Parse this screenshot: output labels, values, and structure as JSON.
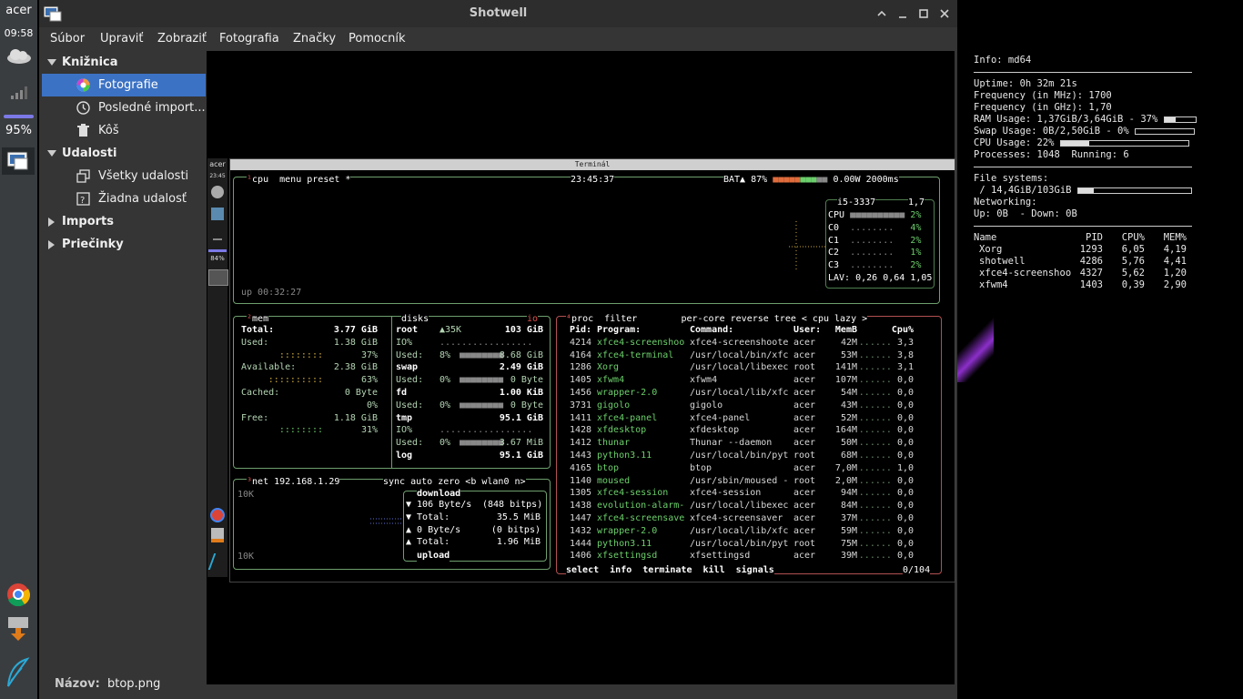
{
  "panel": {
    "user": "acer",
    "clock": "09:58",
    "battery": "95%"
  },
  "shotwell": {
    "title": "Shotwell",
    "menus": [
      "Súbor",
      "Upraviť",
      "Zobraziť",
      "Fotografia",
      "Značky",
      "Pomocník"
    ],
    "sidebar": [
      {
        "label": "Knižnica",
        "level": 0,
        "expand": "open"
      },
      {
        "label": "Fotografie",
        "level": 1,
        "selected": true,
        "icon": "photos-icon"
      },
      {
        "label": "Posledné import...",
        "level": 1,
        "icon": "clock-icon"
      },
      {
        "label": "Kôš",
        "level": 1,
        "icon": "trash-icon"
      },
      {
        "label": "Udalosti",
        "level": 0,
        "expand": "open"
      },
      {
        "label": "Všetky udalosti",
        "level": 1,
        "icon": "events-icon"
      },
      {
        "label": "Žiadna udalosť",
        "level": 1,
        "icon": "no-event-icon"
      },
      {
        "label": "Imports",
        "level": 0,
        "expand": "closed"
      },
      {
        "label": "Priečinky",
        "level": 0,
        "expand": "closed"
      }
    ],
    "status": {
      "label": "Názov:",
      "value": "btop.png"
    }
  },
  "terminal": {
    "title": "Terminál",
    "inner_user": "acer",
    "inner_time": "23:45",
    "inner_batt": "84%",
    "cpu_header": {
      "tabs": [
        "cpu",
        "menu",
        "preset *"
      ],
      "clock": "23:45:37",
      "bat": "BAT▲ 87%",
      "power": "0.00W",
      "rate": "2000ms"
    },
    "cpu_box": {
      "model": "i5-3337",
      "freq": "1,7",
      "rows": [
        [
          "CPU",
          "2%"
        ],
        [
          "C0",
          "4%"
        ],
        [
          "C1",
          "2%"
        ],
        [
          "C2",
          "1%"
        ],
        [
          "C3",
          "2%"
        ]
      ],
      "lav": "LAV: 0,26 0,64 1,05",
      "uptime": "up 00:32:27"
    },
    "mem": {
      "title": "mem",
      "rows": [
        [
          "Total:",
          "3.77 GiB"
        ],
        [
          "Used:",
          "1.38 GiB"
        ],
        [
          "",
          "37%"
        ],
        [
          "Available:",
          "2.38 GiB"
        ],
        [
          "",
          "63%"
        ],
        [
          "Cached:",
          "0 Byte"
        ],
        [
          "",
          "0%"
        ],
        [
          "Free:",
          "1.18 GiB"
        ],
        [
          "",
          "31%"
        ]
      ]
    },
    "disks": {
      "title": "disks",
      "rows": [
        [
          "root",
          "▲35K",
          "103 GiB"
        ],
        [
          "IO%",
          "",
          ""
        ],
        [
          "Used:",
          "8%",
          "8.68 GiB"
        ],
        [
          "swap",
          "",
          "2.49 GiB"
        ],
        [
          "Used:",
          "0%",
          "0 Byte"
        ],
        [
          "fd",
          "",
          "1.00 KiB"
        ],
        [
          "Used:",
          "0%",
          "0 Byte"
        ],
        [
          "tmp",
          "",
          "95.1 GiB"
        ],
        [
          "IO%",
          "",
          ""
        ],
        [
          "Used:",
          "0%",
          "3.67 MiB"
        ],
        [
          "log",
          "",
          "95.1 GiB"
        ]
      ]
    },
    "net": {
      "title": "net",
      "ip": "192.168.1.29",
      "tabs": "sync auto zero <b wlan0 n>",
      "scale_top": "10K",
      "scale_bot": "10K",
      "download": "download",
      "rows": [
        [
          "▼ 106 Byte/s",
          "(848 bitps)"
        ],
        [
          "▼ Total:",
          "35.5 MiB"
        ],
        [
          "▲ 0 Byte/s",
          "(0 bitps)"
        ],
        [
          "▲ Total:",
          "1.96 MiB"
        ]
      ],
      "upload": "upload"
    },
    "proc": {
      "header": "proc  filter        per-core reverse tree < cpu lazy >",
      "cols": [
        "Pid:",
        "Program:",
        "Command:",
        "User:",
        "MemB",
        "Cpu%"
      ],
      "rows": [
        [
          "4214",
          "xfce4-screenshoo",
          "xfce4-screenshoote",
          "acer",
          "42M",
          "3,3"
        ],
        [
          "4164",
          "xfce4-terminal",
          "/usr/local/bin/xfc",
          "acer",
          "53M",
          "3,8"
        ],
        [
          "1286",
          "Xorg",
          "/usr/local/libexec",
          "root",
          "141M",
          "3,1"
        ],
        [
          "1405",
          "xfwm4",
          "xfwm4",
          "acer",
          "107M",
          "0,0"
        ],
        [
          "1456",
          "wrapper-2.0",
          "/usr/local/lib/xfc",
          "acer",
          "54M",
          "0,0"
        ],
        [
          "3731",
          "gigolo",
          "gigolo",
          "acer",
          "43M",
          "0,0"
        ],
        [
          "1411",
          "xfce4-panel",
          "xfce4-panel",
          "acer",
          "52M",
          "0,0"
        ],
        [
          "1428",
          "xfdesktop",
          "xfdesktop",
          "acer",
          "164M",
          "0,0"
        ],
        [
          "1412",
          "thunar",
          "Thunar --daemon",
          "acer",
          "50M",
          "0,0"
        ],
        [
          "1443",
          "python3.11",
          "/usr/local/bin/pyt",
          "root",
          "68M",
          "0,0"
        ],
        [
          "4165",
          "btop",
          "btop",
          "acer",
          "7,0M",
          "1,0"
        ],
        [
          "1140",
          "moused",
          "/usr/sbin/moused -",
          "root",
          "2,0M",
          "0,0"
        ],
        [
          "1305",
          "xfce4-session",
          "xfce4-session",
          "acer",
          "94M",
          "0,0"
        ],
        [
          "1438",
          "evolution-alarm-",
          "/usr/local/libexec",
          "acer",
          "84M",
          "0,0"
        ],
        [
          "1447",
          "xfce4-screensave",
          "xfce4-screensaver",
          "acer",
          "37M",
          "0,0"
        ],
        [
          "1432",
          "wrapper-2.0",
          "/usr/local/lib/xfc",
          "acer",
          "59M",
          "0,0"
        ],
        [
          "1444",
          "python3.11",
          "/usr/local/bin/pyt",
          "root",
          "75M",
          "0,0"
        ],
        [
          "1406",
          "xfsettingsd",
          "xfsettingsd",
          "acer",
          "39M",
          "0,0"
        ]
      ],
      "footer": "select  info  terminate  kill  signals",
      "count": "0/104"
    }
  },
  "conky": {
    "info": "Info: md64",
    "lines": [
      "Uptime: 0h 32m 21s",
      "Frequency (in MHz): 1700",
      "Frequency (in GHz): 1,70"
    ],
    "ram": "RAM Usage: 1,37GiB/3,64GiB - 37%",
    "ram_pct": 37,
    "swap": "Swap Usage: 0B/2,50GiB - 0%",
    "swap_pct": 0,
    "cpu": "CPU Usage: 22%",
    "cpu_pct": 22,
    "procs": "Processes: 1048  Running: 6",
    "fs_title": "File systems:",
    "fs": " / 14,4GiB/103GiB",
    "fs_pct": 14,
    "net_title": "Networking:",
    "net": "Up: 0B  - Down: 0B",
    "top_header": [
      "Name",
      "PID",
      "CPU%",
      "MEM%"
    ],
    "top": [
      [
        "Xorg",
        "1293",
        "6,05",
        "4,19"
      ],
      [
        "shotwell",
        "4286",
        "5,76",
        "4,41"
      ],
      [
        "xfce4-screenshoo",
        "4327",
        "5,62",
        "1,20"
      ],
      [
        "xfwm4",
        "1403",
        "0,39",
        "2,90"
      ]
    ]
  }
}
